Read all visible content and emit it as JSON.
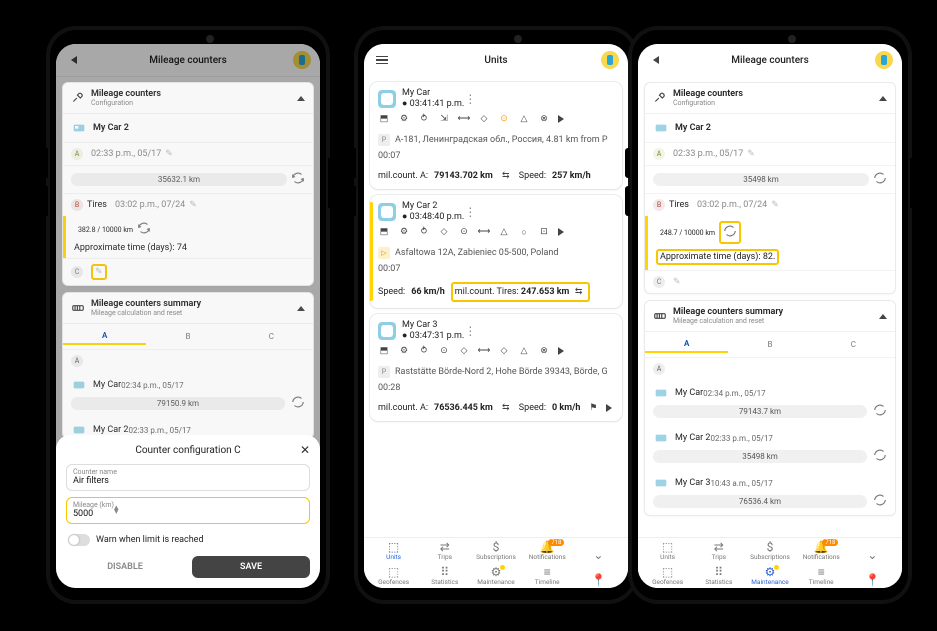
{
  "phone1": {
    "appbar": {
      "title": "Mileage counters"
    },
    "config": {
      "header": "Mileage counters",
      "sub": "Configuration",
      "unit": "My Car 2",
      "counters": {
        "A": {
          "label": "A",
          "time": "02:33 p.m., 05/17",
          "value": "35632.1 km"
        },
        "B": {
          "label": "B",
          "name": "Tires",
          "time": "03:02 p.m., 07/24",
          "value": "382.8 / 10000 km",
          "approx": "Approximate time (days): 74"
        },
        "C": {
          "label": "C"
        }
      }
    },
    "summary": {
      "header": "Mileage counters summary",
      "sub": "Mileage calculation and reset",
      "tabs": [
        "A",
        "B",
        "C"
      ],
      "rows": [
        {
          "label": "A"
        },
        {
          "name": "My Car",
          "time": "02:34 p.m., 05/17",
          "value": "79150.9 km"
        },
        {
          "name": "My Car 2",
          "time": "02:33 p.m., 05/17"
        }
      ]
    },
    "dialog": {
      "title": "Counter configuration C",
      "name_label": "Counter name",
      "name_value": "Air filters",
      "mileage_label": "Mileage (km)",
      "mileage_value": "5000",
      "warn": "Warn when limit is reached",
      "disable": "DISABLE",
      "save": "SAVE"
    }
  },
  "phone2": {
    "appbar": {
      "title": "Units"
    },
    "units": [
      {
        "name": "My Car",
        "time": "03:41:41 p.m.",
        "addr": "A-181, Ленинградская обл., Россия, 4.81 km from P",
        "addr_time": "00:07",
        "foot_a": "mil.count. A:",
        "foot_av": "79143.702 km",
        "speed_l": "Speed:",
        "speed": "257 km/h"
      },
      {
        "name": "My Car 2",
        "time": "03:48:40 p.m.",
        "addr": "Asfaltowa 12A, Żabieniec 05-500, Poland",
        "addr_time": "00:07",
        "speed_l": "Speed:",
        "speed": "66 km/h",
        "mil_l": "mil.count. Tires:",
        "mil_v": "247.653 km",
        "sel": true
      },
      {
        "name": "My Car 3",
        "time": "03:47:31 p.m.",
        "addr": "Raststätte Börde-Nord 2, Hohe Börde 39343, Börde, G",
        "addr_time": "00:28",
        "foot_a": "mil.count. A:",
        "foot_av": "76536.445 km",
        "speed_l": "Speed:",
        "speed": "0 km/h"
      }
    ],
    "nav": {
      "row1": [
        "Units",
        "Trips",
        "Subscriptions",
        "Notifications"
      ],
      "row2": [
        "Geofences",
        "Statistics",
        "Maintenance",
        "Timeline"
      ],
      "badge": "718"
    }
  },
  "phone3": {
    "appbar": {
      "title": "Mileage counters"
    },
    "config": {
      "header": "Mileage counters",
      "sub": "Configuration",
      "unit": "My Car 2",
      "counters": {
        "A": {
          "label": "A",
          "time": "02:33 p.m., 05/17",
          "value": "35498 km"
        },
        "B": {
          "label": "B",
          "name": "Tires",
          "time": "03:02 p.m., 07/24",
          "value": "248.7 / 10000 km",
          "approx": "Approximate time (days): 82."
        },
        "C": {
          "label": "C"
        }
      }
    },
    "summary": {
      "header": "Mileage counters summary",
      "sub": "Mileage calculation and reset",
      "tabs": [
        "A",
        "B",
        "C"
      ],
      "rows": [
        {
          "label": "A"
        },
        {
          "name": "My Car",
          "time": "02:34 p.m., 05/17",
          "value": "79143.7 km"
        },
        {
          "name": "My Car 2",
          "time": "02:33 p.m., 05/17",
          "value": "35498 km"
        },
        {
          "name": "My Car 3",
          "time": "10:43 a.m., 05/17",
          "value": "76536.4 km"
        }
      ]
    },
    "nav": {
      "row1": [
        "Units",
        "Trips",
        "Subscriptions",
        "Notifications"
      ],
      "row2": [
        "Geofences",
        "Statistics",
        "Maintenance",
        "Timeline"
      ],
      "badge": "718"
    }
  }
}
